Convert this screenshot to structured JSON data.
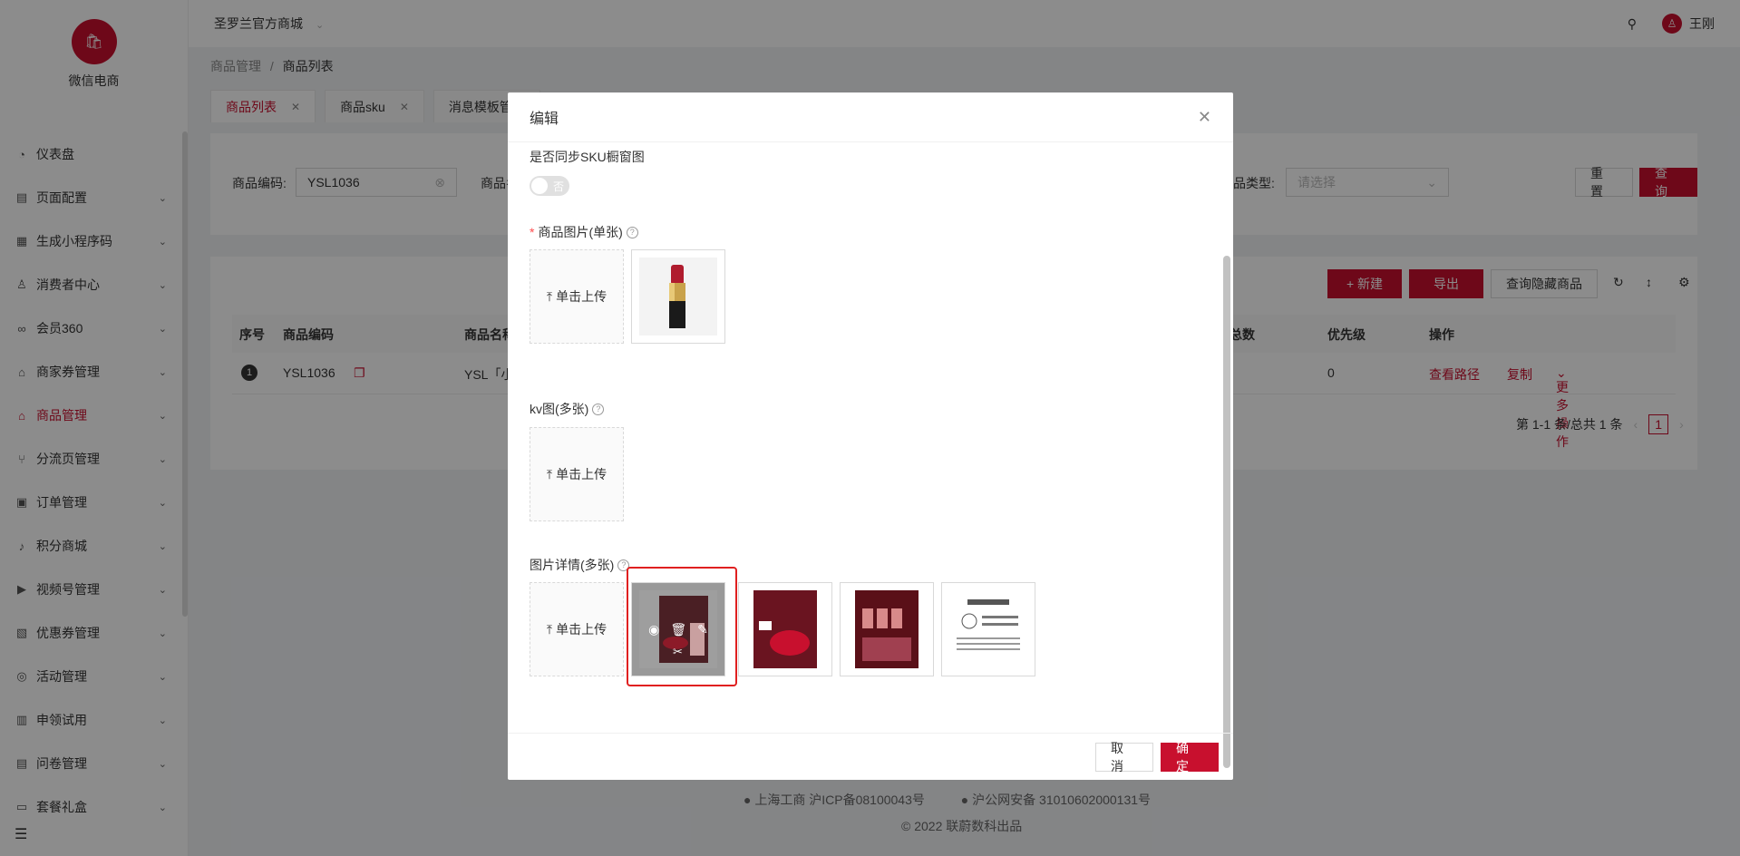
{
  "app": {
    "logo_small": "微信电商",
    "name": "微信电商",
    "collapse_icon": "menu-fold-icon"
  },
  "header": {
    "store": "圣罗兰官方商城",
    "user": "王刚"
  },
  "sidebar": {
    "items": [
      {
        "label": "仪表盘"
      },
      {
        "label": "页面配置"
      },
      {
        "label": "生成小程序码"
      },
      {
        "label": "消费者中心"
      },
      {
        "label": "会员360"
      },
      {
        "label": "商家券管理"
      },
      {
        "label": "商品管理",
        "active": true
      },
      {
        "label": "分流页管理"
      },
      {
        "label": "订单管理"
      },
      {
        "label": "积分商城"
      },
      {
        "label": "视频号管理"
      },
      {
        "label": "优惠券管理"
      },
      {
        "label": "活动管理"
      },
      {
        "label": "申领试用"
      },
      {
        "label": "问卷管理"
      },
      {
        "label": "套餐礼盒"
      }
    ]
  },
  "breadcrumb": {
    "parent": "商品管理",
    "sep": "/",
    "current": "商品列表"
  },
  "tabs": [
    {
      "label": "商品列表",
      "active": true
    },
    {
      "label": "商品sku"
    },
    {
      "label": "消息模板管理"
    }
  ],
  "filter": {
    "code_label": "商品编码:",
    "code_value": "YSL1036",
    "name_label": "商品名",
    "type_label": "品类型:",
    "type_placeholder": "请选择",
    "reset": "重 置",
    "search": "查 询"
  },
  "toolbar": {
    "new": "+ 新建",
    "export": "导出",
    "hidden": "查询隐藏商品"
  },
  "table": {
    "headers": [
      "序号",
      "商品编码",
      "商品名称",
      "总数",
      "优先级",
      "操作"
    ],
    "rows": [
      {
        "index": "1",
        "code": "YSL1036",
        "name": "YSL「小",
        "priority": "0",
        "view_path": "查看路径",
        "copy": "复制",
        "more": "更多操作"
      }
    ],
    "pagination": {
      "summary": "第 1-1 条/总共 1 条",
      "page": "1"
    }
  },
  "footer": {
    "icp": "上海工商  沪ICP备08100043号",
    "police": "沪公网安备 31010602000131号",
    "copyright": "© 2022 联蔚数科出品"
  },
  "modal": {
    "title": "编辑",
    "sync_label": "是否同步SKU橱窗图",
    "sync_toggle": "否",
    "main_image_label": "商品图片(单张)",
    "kv_label": "kv图(多张)",
    "detail_label": "图片详情(多张)",
    "upload_text": "单击上传",
    "cancel": "取 消",
    "ok": "确 定"
  }
}
